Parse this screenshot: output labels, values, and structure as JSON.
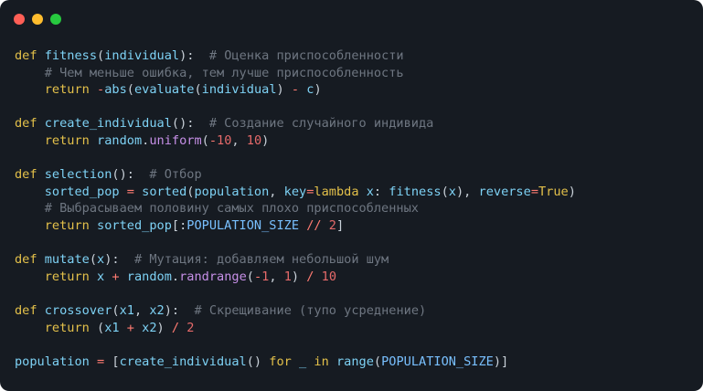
{
  "window": {
    "buttons": [
      {
        "name": "close",
        "color": "#ff5f56"
      },
      {
        "name": "minimize",
        "color": "#ffbd2e"
      },
      {
        "name": "maximize",
        "color": "#27c93f"
      }
    ]
  },
  "code": {
    "lines": [
      [
        [
          "kw",
          "def "
        ],
        [
          "fn",
          "fitness"
        ],
        [
          "plain",
          "("
        ],
        [
          "fn",
          "individual"
        ],
        [
          "plain",
          "):  "
        ],
        [
          "comment",
          "# Оценка приспособленности"
        ]
      ],
      [
        [
          "plain",
          "    "
        ],
        [
          "comment",
          "# Чем меньше ошибка, тем лучше приспособленность"
        ]
      ],
      [
        [
          "plain",
          "    "
        ],
        [
          "kw",
          "return "
        ],
        [
          "op",
          "-"
        ],
        [
          "fn",
          "abs"
        ],
        [
          "plain",
          "("
        ],
        [
          "fn",
          "evaluate"
        ],
        [
          "plain",
          "("
        ],
        [
          "fn",
          "individual"
        ],
        [
          "plain",
          ") "
        ],
        [
          "op",
          "-"
        ],
        [
          "plain",
          " "
        ],
        [
          "fn",
          "c"
        ],
        [
          "plain",
          ")"
        ]
      ],
      [],
      [
        [
          "kw",
          "def "
        ],
        [
          "fn",
          "create_individual"
        ],
        [
          "plain",
          "():  "
        ],
        [
          "comment",
          "# Создание случайного индивида"
        ]
      ],
      [
        [
          "plain",
          "    "
        ],
        [
          "kw",
          "return "
        ],
        [
          "fn",
          "random"
        ],
        [
          "plain",
          "."
        ],
        [
          "meth",
          "uniform"
        ],
        [
          "plain",
          "("
        ],
        [
          "op",
          "-"
        ],
        [
          "num",
          "10"
        ],
        [
          "plain",
          ", "
        ],
        [
          "num",
          "10"
        ],
        [
          "plain",
          ")"
        ]
      ],
      [],
      [
        [
          "kw",
          "def "
        ],
        [
          "fn",
          "selection"
        ],
        [
          "plain",
          "():  "
        ],
        [
          "comment",
          "# Отбор"
        ]
      ],
      [
        [
          "plain",
          "    "
        ],
        [
          "fn",
          "sorted_pop"
        ],
        [
          "plain",
          " "
        ],
        [
          "op",
          "="
        ],
        [
          "plain",
          " "
        ],
        [
          "fn",
          "sorted"
        ],
        [
          "plain",
          "("
        ],
        [
          "fn",
          "population"
        ],
        [
          "plain",
          ", "
        ],
        [
          "fn",
          "key"
        ],
        [
          "op",
          "="
        ],
        [
          "kw",
          "lambda "
        ],
        [
          "fn",
          "x"
        ],
        [
          "plain",
          ": "
        ],
        [
          "fn",
          "fitness"
        ],
        [
          "plain",
          "("
        ],
        [
          "fn",
          "x"
        ],
        [
          "plain",
          "), "
        ],
        [
          "fn",
          "reverse"
        ],
        [
          "op",
          "="
        ],
        [
          "kw",
          "True"
        ],
        [
          "plain",
          ")"
        ]
      ],
      [
        [
          "plain",
          "    "
        ],
        [
          "comment",
          "# Выбрасываем половину самых плохо приспособленных"
        ]
      ],
      [
        [
          "plain",
          "    "
        ],
        [
          "kw",
          "return "
        ],
        [
          "fn",
          "sorted_pop"
        ],
        [
          "plain",
          "[:"
        ],
        [
          "blue",
          "POPULATION_SIZE"
        ],
        [
          "plain",
          " "
        ],
        [
          "op",
          "//"
        ],
        [
          "plain",
          " "
        ],
        [
          "num",
          "2"
        ],
        [
          "plain",
          "]"
        ]
      ],
      [],
      [
        [
          "kw",
          "def "
        ],
        [
          "fn",
          "mutate"
        ],
        [
          "plain",
          "("
        ],
        [
          "fn",
          "x"
        ],
        [
          "plain",
          "):  "
        ],
        [
          "comment",
          "# Мутация: добавляем небольшой шум"
        ]
      ],
      [
        [
          "plain",
          "    "
        ],
        [
          "kw",
          "return "
        ],
        [
          "fn",
          "x"
        ],
        [
          "plain",
          " "
        ],
        [
          "op",
          "+"
        ],
        [
          "plain",
          " "
        ],
        [
          "fn",
          "random"
        ],
        [
          "plain",
          "."
        ],
        [
          "meth",
          "randrange"
        ],
        [
          "plain",
          "("
        ],
        [
          "op",
          "-"
        ],
        [
          "num",
          "1"
        ],
        [
          "plain",
          ", "
        ],
        [
          "num",
          "1"
        ],
        [
          "plain",
          ") "
        ],
        [
          "op",
          "/"
        ],
        [
          "plain",
          " "
        ],
        [
          "num",
          "10"
        ]
      ],
      [],
      [
        [
          "kw",
          "def "
        ],
        [
          "fn",
          "crossover"
        ],
        [
          "plain",
          "("
        ],
        [
          "fn",
          "x1"
        ],
        [
          "plain",
          ", "
        ],
        [
          "fn",
          "x2"
        ],
        [
          "plain",
          "):  "
        ],
        [
          "comment",
          "# Скрещивание (тупо усреднение)"
        ]
      ],
      [
        [
          "plain",
          "    "
        ],
        [
          "kw",
          "return "
        ],
        [
          "plain",
          "("
        ],
        [
          "fn",
          "x1"
        ],
        [
          "plain",
          " "
        ],
        [
          "op",
          "+"
        ],
        [
          "plain",
          " "
        ],
        [
          "fn",
          "x2"
        ],
        [
          "plain",
          ") "
        ],
        [
          "op",
          "/"
        ],
        [
          "plain",
          " "
        ],
        [
          "num",
          "2"
        ]
      ],
      [],
      [
        [
          "fn",
          "population"
        ],
        [
          "plain",
          " "
        ],
        [
          "op",
          "="
        ],
        [
          "plain",
          " ["
        ],
        [
          "fn",
          "create_individual"
        ],
        [
          "plain",
          "() "
        ],
        [
          "kw",
          "for "
        ],
        [
          "fn",
          "_"
        ],
        [
          "plain",
          " "
        ],
        [
          "kw",
          "in "
        ],
        [
          "fn",
          "range"
        ],
        [
          "plain",
          "("
        ],
        [
          "blue",
          "POPULATION_SIZE"
        ],
        [
          "plain",
          ")]"
        ]
      ]
    ]
  }
}
